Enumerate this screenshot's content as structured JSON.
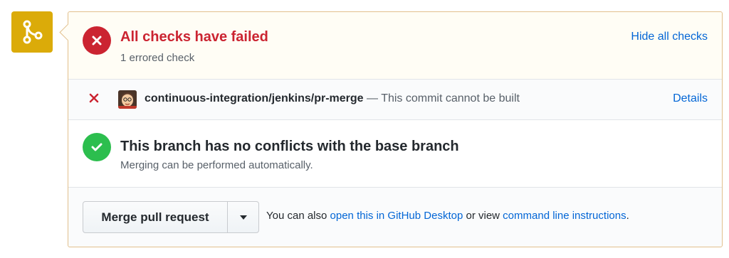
{
  "status": {
    "title": "All checks have failed",
    "subtitle": "1 errored check",
    "hide_link": "Hide all checks",
    "icon": "x-icon",
    "color": "#cb2431"
  },
  "check": {
    "name": "continuous-integration/jenkins/pr-merge",
    "description": "— This commit cannot be built",
    "details_link": "Details",
    "status_icon": "x-icon"
  },
  "branch": {
    "title": "This branch has no conflicts with the base branch",
    "subtitle": "Merging can be performed automatically.",
    "icon": "check-icon",
    "color": "#2cbe4e"
  },
  "merge": {
    "button_label": "Merge pull request",
    "hint_prefix": "You can also",
    "desktop_link": "open this in GitHub Desktop",
    "hint_middle": "or view",
    "cli_link": "command line instructions",
    "hint_suffix": "."
  },
  "colors": {
    "warning_icon_bg": "#dbab09",
    "link": "#0366d6",
    "panel_border": "#e2c08d"
  }
}
